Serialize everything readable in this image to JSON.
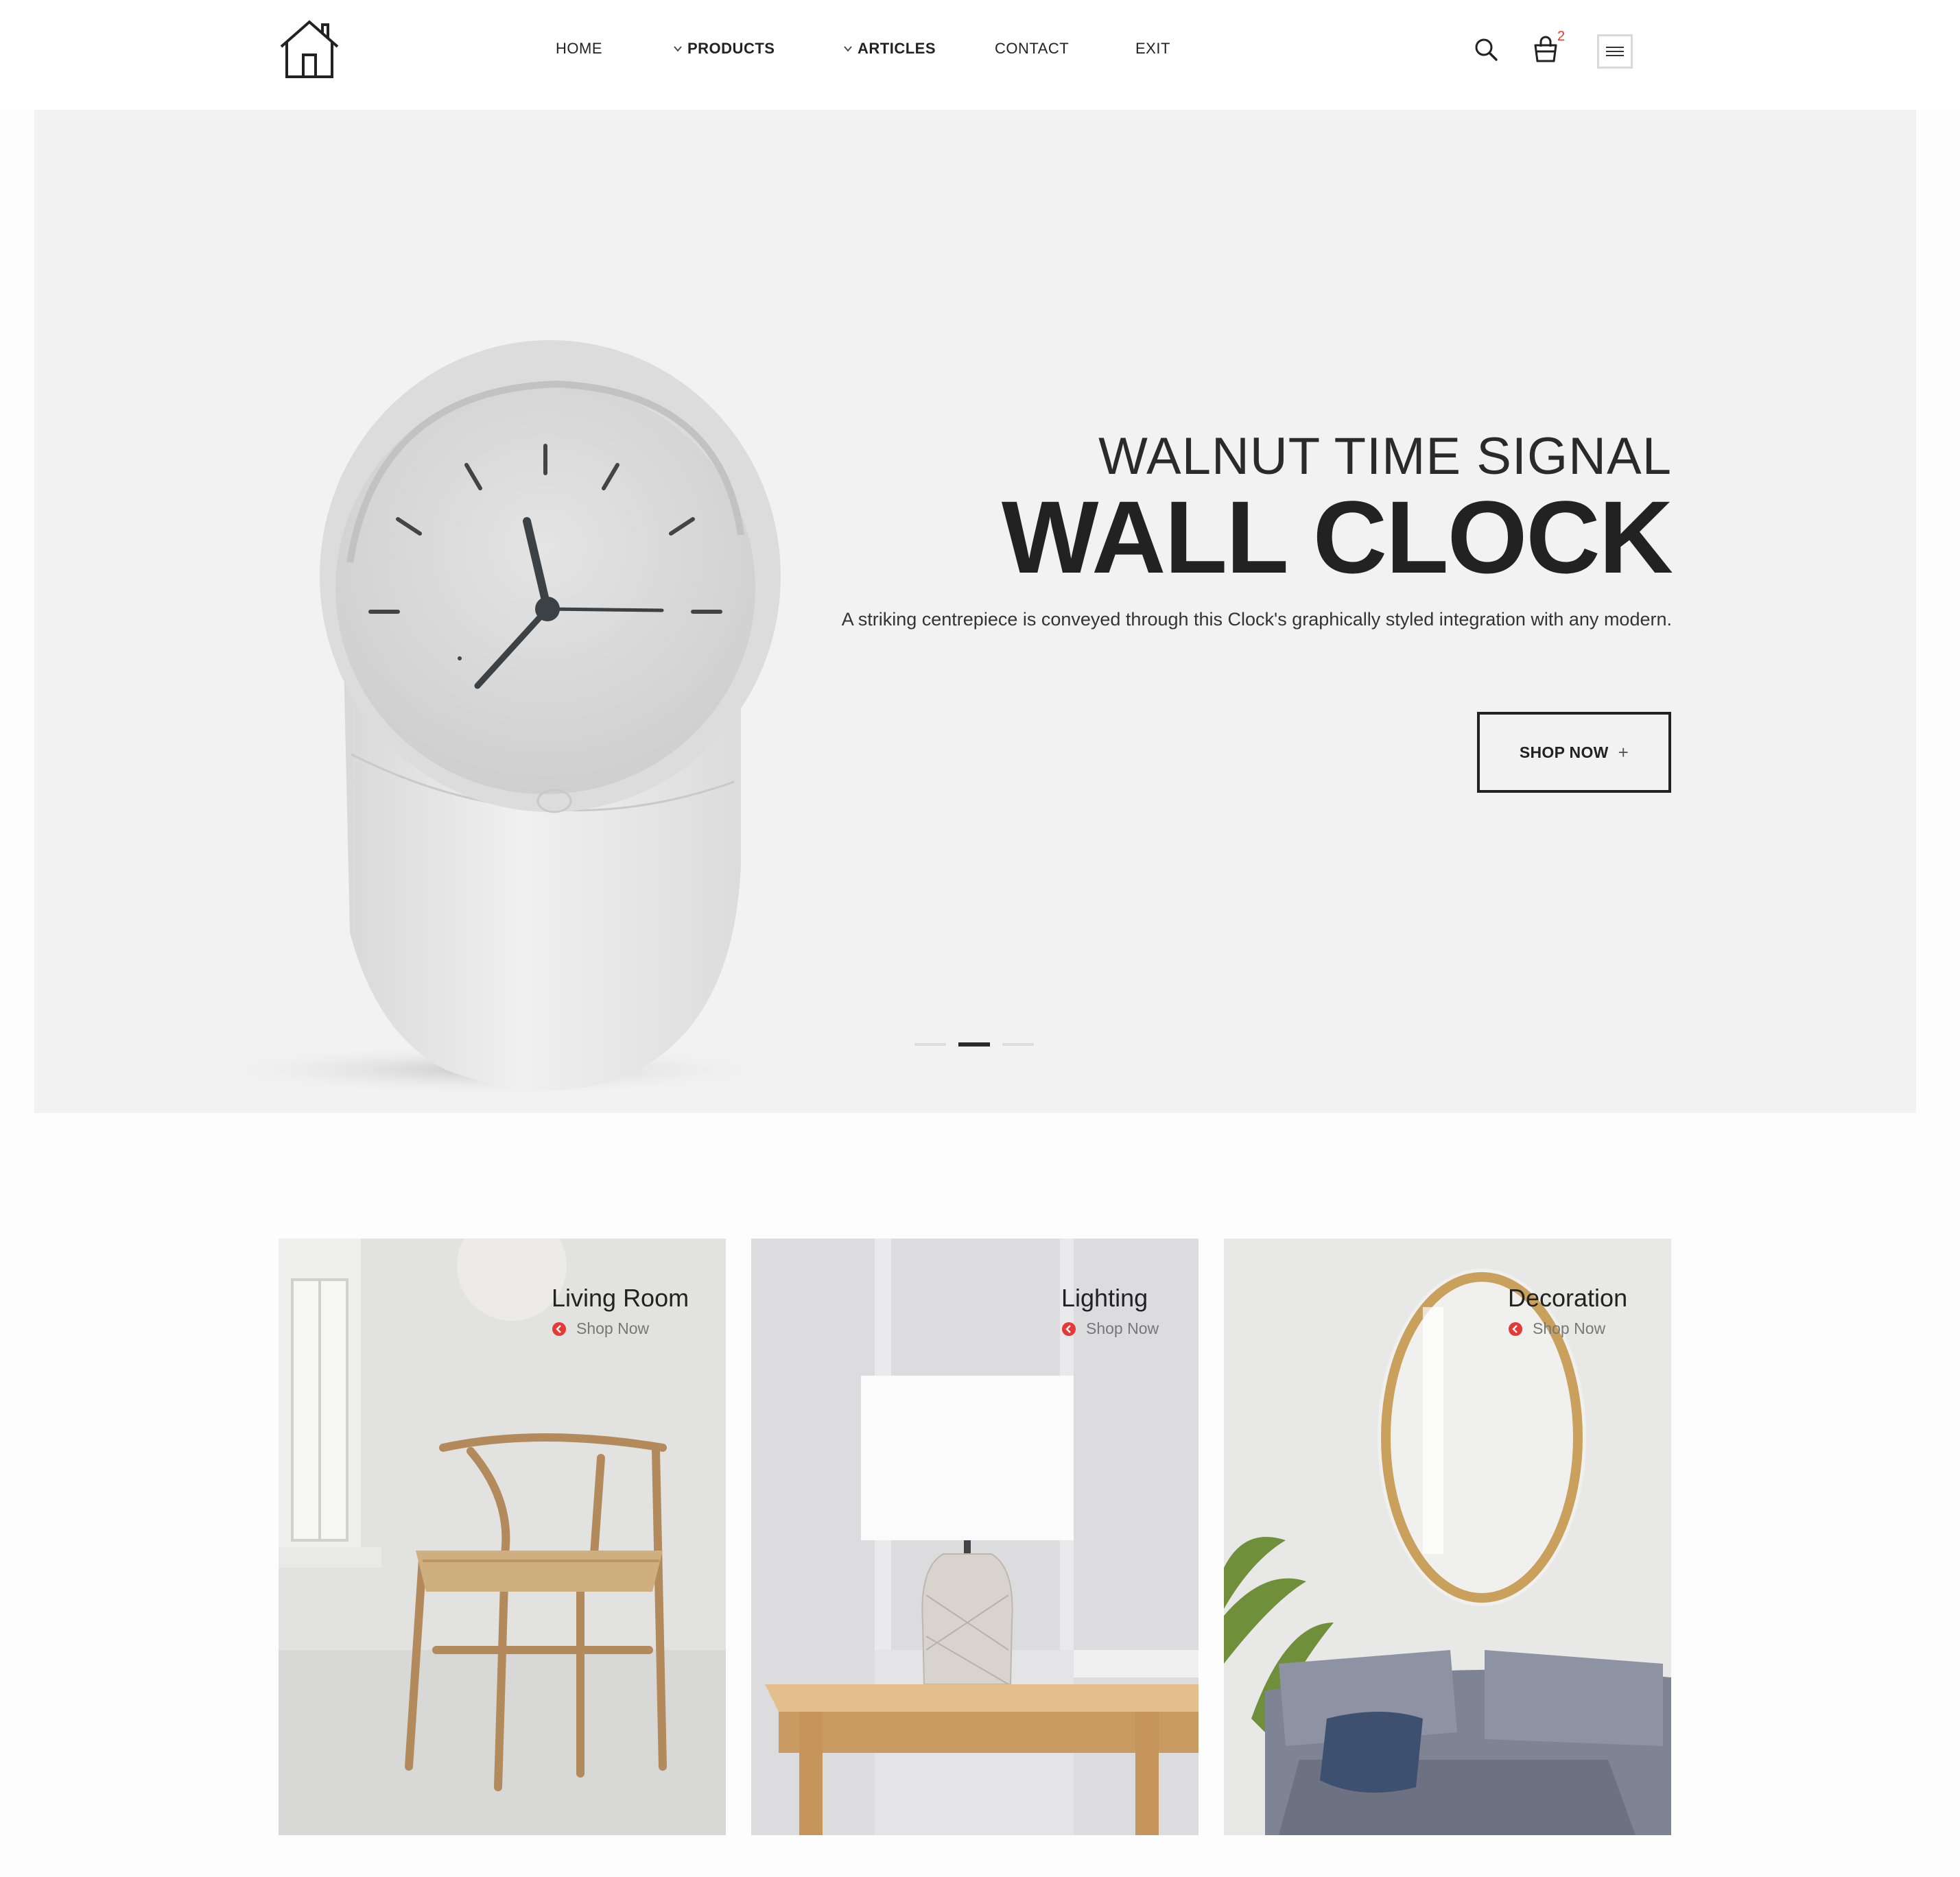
{
  "header": {
    "nav": [
      {
        "label": "HOME",
        "has_dropdown": false
      },
      {
        "label": "PRODUCTS",
        "has_dropdown": true
      },
      {
        "label": "ARTICLES",
        "has_dropdown": true
      },
      {
        "label": "CONTACT",
        "has_dropdown": false
      },
      {
        "label": "EXIT",
        "has_dropdown": false
      }
    ],
    "cart_count": "2",
    "icons": [
      "home-logo-icon",
      "search-icon",
      "shopping-bag-icon",
      "hamburger-menu-icon",
      "chevron-down-icon"
    ]
  },
  "hero": {
    "subtitle": "WALNUT TIME SIGNAL",
    "title": "WALL CLOCK",
    "description": "A striking centrepiece is conveyed through this Clock's graphically styled integration with any modern.",
    "button_label": "SHOP NOW",
    "button_icon": "plus-icon",
    "slides_total": 3,
    "active_slide": 2
  },
  "categories": [
    {
      "title": "Living Room",
      "link": "Shop Now"
    },
    {
      "title": "Lighting",
      "link": "Shop Now"
    },
    {
      "title": "Decoration",
      "link": "Shop Now"
    }
  ],
  "colors": {
    "accent": "#e53935",
    "text": "#222222",
    "hero_bg": "#f2f2f2",
    "page_bg": "#fdfdfd"
  }
}
